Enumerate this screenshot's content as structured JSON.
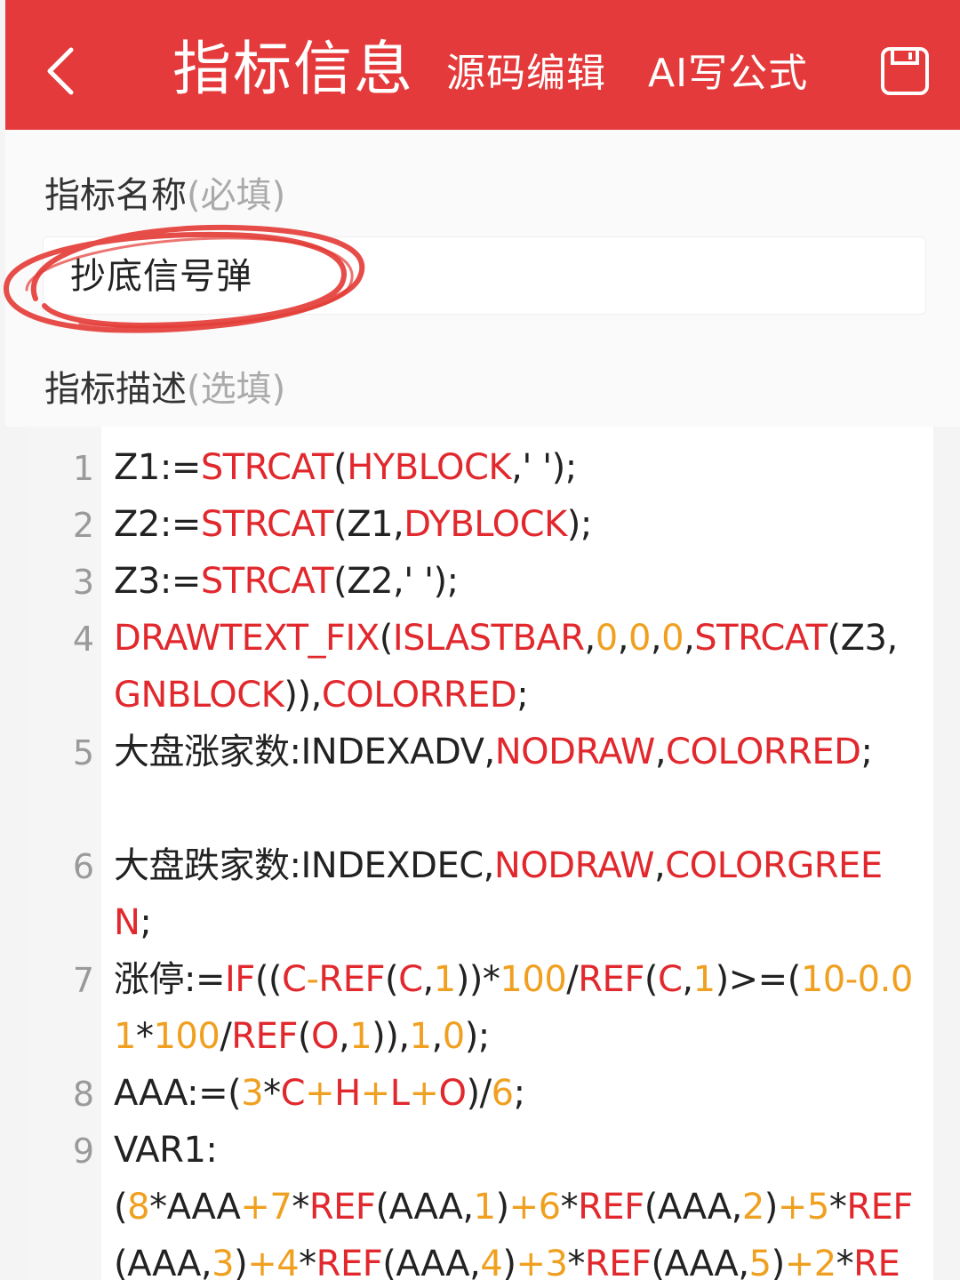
{
  "header": {
    "title": "指标信息",
    "source_edit": "源码编辑",
    "ai_formula": "AI写公式"
  },
  "form": {
    "name_label": "指标名称",
    "name_hint": "(必填)",
    "name_value": "抄底信号弹",
    "desc_label": "指标描述",
    "desc_hint": "(选填)"
  },
  "colors": {
    "header_bg": "#e53a3b",
    "function": "#e1282d",
    "number": "#f0a020",
    "annotation_circle": "#e33a34"
  },
  "editor": {
    "lines": [
      {
        "num": "1",
        "tokens": [
          [
            "Z1:=",
            "plain"
          ],
          [
            "STRCAT",
            "fn"
          ],
          [
            "(",
            "plain"
          ],
          [
            "HYBLOCK",
            "fn"
          ],
          [
            ",' ');",
            "plain"
          ]
        ]
      },
      {
        "num": "2",
        "tokens": [
          [
            "Z2:=",
            "plain"
          ],
          [
            "STRCAT",
            "fn"
          ],
          [
            "(Z1,",
            "plain"
          ],
          [
            "DYBLOCK",
            "fn"
          ],
          [
            ");",
            "plain"
          ]
        ]
      },
      {
        "num": "3",
        "tokens": [
          [
            "Z3:=",
            "plain"
          ],
          [
            "STRCAT",
            "fn"
          ],
          [
            "(Z2,' ');",
            "plain"
          ]
        ]
      },
      {
        "num": "4",
        "tokens": [
          [
            "DRAWTEXT_FIX",
            "fn"
          ],
          [
            "(",
            "plain"
          ],
          [
            "ISLASTBAR",
            "fn"
          ],
          [
            ",",
            "plain"
          ],
          [
            "0",
            "num"
          ],
          [
            ",",
            "plain"
          ],
          [
            "0",
            "num"
          ],
          [
            ",",
            "plain"
          ],
          [
            "0",
            "num"
          ],
          [
            ",",
            "plain"
          ],
          [
            "STRCAT",
            "fn"
          ],
          [
            "(Z3,",
            "plain"
          ],
          [
            "GNBLOCK",
            "fn"
          ],
          [
            ")),",
            "plain"
          ],
          [
            "COLORRED",
            "fn"
          ],
          [
            ";",
            "plain"
          ]
        ]
      },
      {
        "num": "5",
        "tokens": [
          [
            "大盘涨家数:INDEXADV,",
            "plain"
          ],
          [
            "NODRAW",
            "fn"
          ],
          [
            ",",
            "plain"
          ],
          [
            "COLORRED",
            "fn"
          ],
          [
            ";",
            "plain"
          ]
        ]
      },
      {
        "num": "6",
        "tokens": [
          [
            "大盘跌家数:INDEXDEC,",
            "plain"
          ],
          [
            "NODRAW",
            "fn"
          ],
          [
            ",",
            "plain"
          ],
          [
            "COLORGREEN",
            "fn"
          ],
          [
            ";",
            "plain"
          ]
        ]
      },
      {
        "num": "7",
        "tokens": [
          [
            "涨停:=",
            "plain"
          ],
          [
            "IF",
            "fn"
          ],
          [
            "((",
            "plain"
          ],
          [
            "C",
            "fn"
          ],
          [
            "-",
            "op"
          ],
          [
            "REF",
            "fn"
          ],
          [
            "(",
            "plain"
          ],
          [
            "C",
            "fn"
          ],
          [
            ",",
            "plain"
          ],
          [
            "1",
            "num"
          ],
          [
            "))*",
            "plain"
          ],
          [
            "100",
            "num"
          ],
          [
            "/",
            "plain"
          ],
          [
            "REF",
            "fn"
          ],
          [
            "(",
            "plain"
          ],
          [
            "C",
            "fn"
          ],
          [
            ",",
            "plain"
          ],
          [
            "1",
            "num"
          ],
          [
            ")>=(",
            "plain"
          ],
          [
            "10",
            "num"
          ],
          [
            "-",
            "op"
          ],
          [
            "0.01",
            "num"
          ],
          [
            "*",
            "plain"
          ],
          [
            "100",
            "num"
          ],
          [
            "/",
            "plain"
          ],
          [
            "REF",
            "fn"
          ],
          [
            "(",
            "plain"
          ],
          [
            "O",
            "fn"
          ],
          [
            ",",
            "plain"
          ],
          [
            "1",
            "num"
          ],
          [
            ")),",
            "plain"
          ],
          [
            "1",
            "num"
          ],
          [
            ",",
            "plain"
          ],
          [
            "0",
            "num"
          ],
          [
            ");",
            "plain"
          ]
        ]
      },
      {
        "num": "8",
        "tokens": [
          [
            "AAA:=(",
            "plain"
          ],
          [
            "3",
            "num"
          ],
          [
            "*",
            "plain"
          ],
          [
            "C",
            "fn"
          ],
          [
            "+",
            "op"
          ],
          [
            "H",
            "fn"
          ],
          [
            "+",
            "op"
          ],
          [
            "L",
            "fn"
          ],
          [
            "+",
            "op"
          ],
          [
            "O",
            "fn"
          ],
          [
            ")/",
            "plain"
          ],
          [
            "6",
            "num"
          ],
          [
            ";",
            "plain"
          ]
        ]
      },
      {
        "num": "9",
        "tokens": [
          [
            "VAR1:\n(",
            "plain"
          ],
          [
            "8",
            "num"
          ],
          [
            "*AAA",
            "plain"
          ],
          [
            "+",
            "op"
          ],
          [
            "7",
            "num"
          ],
          [
            "*",
            "plain"
          ],
          [
            "REF",
            "fn"
          ],
          [
            "(AAA,",
            "plain"
          ],
          [
            "1",
            "num"
          ],
          [
            ")",
            "plain"
          ],
          [
            "+",
            "op"
          ],
          [
            "6",
            "num"
          ],
          [
            "*",
            "plain"
          ],
          [
            "REF",
            "fn"
          ],
          [
            "(AAA,",
            "plain"
          ],
          [
            "2",
            "num"
          ],
          [
            ")",
            "plain"
          ],
          [
            "+",
            "op"
          ],
          [
            "5",
            "num"
          ],
          [
            "*",
            "plain"
          ],
          [
            "REF",
            "fn"
          ],
          [
            "(AAA,",
            "plain"
          ],
          [
            "3",
            "num"
          ],
          [
            ")",
            "plain"
          ],
          [
            "+",
            "op"
          ],
          [
            "4",
            "num"
          ],
          [
            "*",
            "plain"
          ],
          [
            "REF",
            "fn"
          ],
          [
            "(AAA,",
            "plain"
          ],
          [
            "4",
            "num"
          ],
          [
            ")",
            "plain"
          ],
          [
            "+",
            "op"
          ],
          [
            "3",
            "num"
          ],
          [
            "*",
            "plain"
          ],
          [
            "REF",
            "fn"
          ],
          [
            "(AAA,",
            "plain"
          ],
          [
            "5",
            "num"
          ],
          [
            ")",
            "plain"
          ],
          [
            "+",
            "op"
          ],
          [
            "2",
            "num"
          ],
          [
            "*",
            "plain"
          ],
          [
            "RE",
            "fn"
          ]
        ]
      }
    ]
  }
}
